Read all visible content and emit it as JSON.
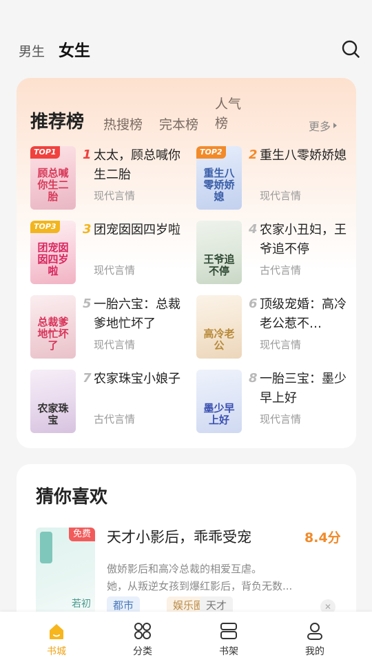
{
  "header": {
    "tabs": [
      {
        "label": "男生",
        "active": false
      },
      {
        "label": "女生",
        "active": true
      }
    ],
    "search_icon": "search-icon"
  },
  "ranking": {
    "title": "推荐榜",
    "tabs": [
      "热搜榜",
      "完本榜",
      "人气榜"
    ],
    "more_label": "更多",
    "books": [
      {
        "rank": "1",
        "badge": "TOP1",
        "title": "太太，顾总喊你生二胎",
        "genre": "现代言情",
        "cover_text": "顾总喊你生二胎"
      },
      {
        "rank": "2",
        "badge": "TOP2",
        "title": "重生八零娇娇媳",
        "genre": "现代言情",
        "cover_text": "重生八零娇娇媳"
      },
      {
        "rank": "3",
        "badge": "TOP3",
        "title": "团宠囡囡四岁啦",
        "genre": "现代言情",
        "cover_text": "团宠囡囡四岁啦"
      },
      {
        "rank": "4",
        "badge": "",
        "title": "农家小丑妇，王爷追不停",
        "genre": "古代言情",
        "cover_text": "王爷追不停"
      },
      {
        "rank": "5",
        "badge": "",
        "title": "一胎六宝：总裁爹地忙坏了",
        "genre": "现代言情",
        "cover_text": "总裁爹地忙坏了"
      },
      {
        "rank": "6",
        "badge": "",
        "title": "顶级宠婚：高冷老公惹不…",
        "genre": "现代言情",
        "cover_text": "高冷老公"
      },
      {
        "rank": "7",
        "badge": "",
        "title": "农家珠宝小娘子",
        "genre": "古代言情",
        "cover_text": "农家珠宝"
      },
      {
        "rank": "8",
        "badge": "",
        "title": "一胎三宝：墨少早上好",
        "genre": "现代言情",
        "cover_text": "墨少早上好"
      }
    ]
  },
  "guess": {
    "title": "猜你喜欢",
    "book": {
      "name": "天才小影后，乖乖受宠",
      "score": "8.4分",
      "free_badge": "免费",
      "cover_text": "若初",
      "desc_line1": "傲娇影后和高冷总裁的相爱互虐。",
      "desc_line2": "她，从叛逆女孩到爆红影后，背负无数...",
      "tags": [
        "都市",
        "娱乐圈",
        "天才"
      ]
    }
  },
  "bottom_nav": [
    {
      "label": "书城",
      "icon": "bookstore-icon",
      "active": true
    },
    {
      "label": "分类",
      "icon": "category-icon",
      "active": false
    },
    {
      "label": "书架",
      "icon": "bookshelf-icon",
      "active": false
    },
    {
      "label": "我的",
      "icon": "profile-icon",
      "active": false
    }
  ],
  "colors": {
    "accent": "#f0a418",
    "score": "#f08a2a",
    "free_badge": "#f25b5b",
    "top1": "#f0413e",
    "top2": "#f28a2a",
    "top3": "#f2b51e"
  }
}
